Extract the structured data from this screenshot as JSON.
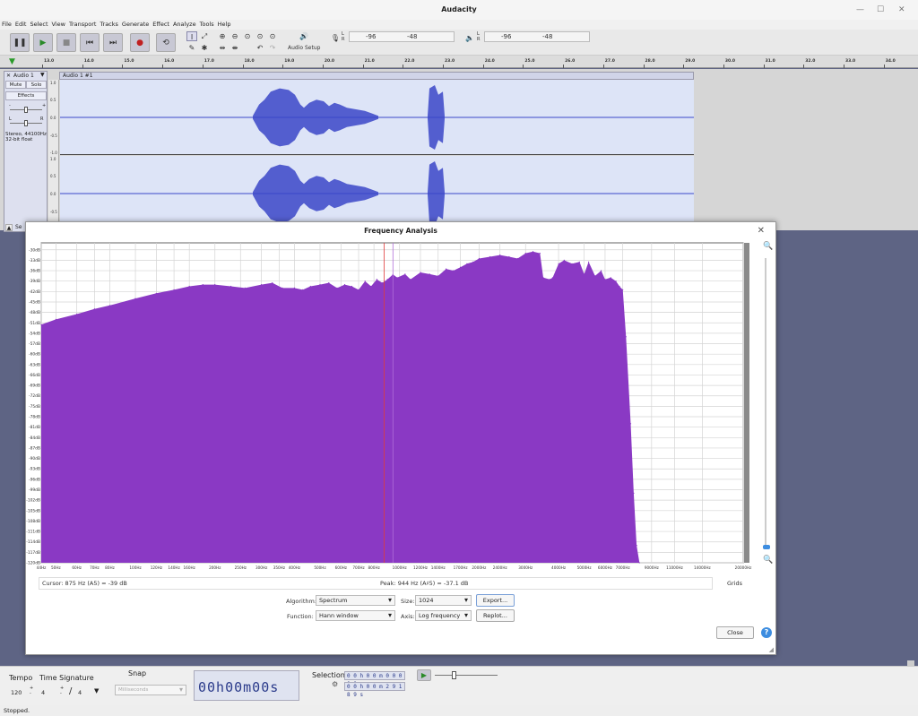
{
  "window": {
    "title": "Audacity"
  },
  "menu": [
    "File",
    "Edit",
    "Select",
    "View",
    "Transport",
    "Tracks",
    "Generate",
    "Effect",
    "Analyze",
    "Tools",
    "Help"
  ],
  "toolbar": {
    "audio_setup_label": "Audio Setup",
    "rec_meter": {
      "ticks": [
        "-96",
        "-48"
      ],
      "lr": "L R"
    },
    "play_meter": {
      "ticks": [
        "-96",
        "-48"
      ],
      "lr": "L R"
    }
  },
  "ruler": {
    "ticks": [
      "13.0",
      "14.0",
      "15.0",
      "16.0",
      "17.0",
      "18.0",
      "19.0",
      "20.0",
      "21.0",
      "22.0",
      "23.0",
      "24.0",
      "25.0",
      "26.0",
      "27.0",
      "28.0",
      "29.0",
      "30.0",
      "31.0",
      "32.0",
      "33.0",
      "34.0"
    ]
  },
  "track": {
    "name": "Audio 1",
    "clip_name": "Audio 1 #1",
    "mute": "Mute",
    "solo": "Solo",
    "effects": "Effects",
    "gain_minus": "-",
    "gain_plus": "+",
    "pan_left": "L",
    "pan_right": "R",
    "info": "Stereo, 44100Hz\n32-bit float",
    "scale": [
      "1.0",
      "0.5",
      "0.0",
      "-0.5",
      "-1.0",
      "1.0",
      "0.5",
      "0.0",
      "-0.5"
    ],
    "select_label": "Se"
  },
  "dialog": {
    "title": "Frequency Analysis",
    "cursor": "Cursor: 875 Hz (A5) = -39 dB",
    "peak": "Peak: 944 Hz (A♯5) = -37.1 dB",
    "grids_label": "Grids",
    "algorithm_label": "Algorithm:",
    "algorithm_value": "Spectrum",
    "size_label": "Size:",
    "size_value": "1024",
    "function_label": "Function:",
    "function_value": "Hann window",
    "axis_label": "Axis:",
    "axis_value": "Log frequency",
    "export_label": "Export...",
    "replot_label": "Replot...",
    "close_label": "Close",
    "help_label": "?"
  },
  "bottom": {
    "tempo_label": "Tempo",
    "tempo_value": "120",
    "time_sig_label": "Time Signature",
    "time_sig_num": "4",
    "time_sig_den": "4",
    "snap_label": "Snap",
    "snap_value": "Milliseconds",
    "time_display": "00h00m00s",
    "selection_label": "Selection",
    "sel_start": "0 0 h 0 0 m 0 0 0 0 0 s",
    "sel_end": "0 0 h 0 0 m 2 9 1 8 9 s"
  },
  "status": "Stopped.",
  "colors": {
    "spectrum_fill": "#8a39c4",
    "waveform": "#3b47c8",
    "cursor_line": "#e03b3b"
  },
  "chart_data": {
    "type": "area",
    "title": "",
    "xlabel": "",
    "ylabel": "",
    "x_scale": "log",
    "y_ticks": [
      "-30dB",
      "-33dB",
      "-36dB",
      "-39dB",
      "-42dB",
      "-45dB",
      "-48dB",
      "-51dB",
      "-54dB",
      "-57dB",
      "-60dB",
      "-63dB",
      "-66dB",
      "-69dB",
      "-72dB",
      "-75dB",
      "-78dB",
      "-81dB",
      "-84dB",
      "-87dB",
      "-90dB",
      "-93dB",
      "-96dB",
      "-99dB",
      "-102dB",
      "-105dB",
      "-108dB",
      "-111dB",
      "-114dB",
      "-117dB",
      "-120dB"
    ],
    "x_ticks": [
      "44Hz",
      "50Hz",
      "60Hz",
      "70Hz",
      "80Hz",
      "100Hz",
      "120Hz",
      "140Hz",
      "160Hz",
      "200Hz",
      "250Hz",
      "300Hz",
      "350Hz",
      "400Hz",
      "500Hz",
      "600Hz",
      "700Hz",
      "800Hz",
      "1000Hz",
      "1200Hz",
      "1400Hz",
      "1700Hz",
      "2000Hz",
      "2400Hz",
      "3000Hz",
      "4000Hz",
      "5000Hz",
      "6000Hz",
      "7000Hz",
      "9000Hz",
      "11000Hz",
      "14000Hz",
      "20000Hz"
    ],
    "xlim": [
      44,
      20000
    ],
    "ylim": [
      -120,
      -28
    ],
    "grid": true,
    "cursor_hz": 875,
    "peak_hz": 944,
    "x": [
      44,
      50,
      60,
      70,
      80,
      100,
      120,
      140,
      160,
      180,
      200,
      230,
      260,
      300,
      330,
      360,
      400,
      430,
      460,
      500,
      540,
      580,
      620,
      660,
      700,
      740,
      780,
      820,
      860,
      900,
      944,
      980,
      1050,
      1100,
      1200,
      1300,
      1400,
      1500,
      1600,
      1700,
      1800,
      1900,
      2000,
      2200,
      2400,
      2600,
      2800,
      3000,
      3200,
      3400,
      3500,
      3700,
      3800,
      4000,
      4200,
      4500,
      4800,
      5000,
      5200,
      5500,
      5800,
      6000,
      6300,
      6600,
      6800,
      7000,
      7200,
      7500,
      7700,
      7900,
      8100
    ],
    "values": [
      -51.5,
      -50.0,
      -48.5,
      -47.0,
      -46.0,
      -44.0,
      -42.5,
      -41.5,
      -40.5,
      -40.0,
      -40.0,
      -40.5,
      -41.0,
      -40.0,
      -39.5,
      -41.0,
      -41.0,
      -41.5,
      -40.5,
      -40.0,
      -39.5,
      -41.0,
      -40.0,
      -40.5,
      -41.5,
      -39.0,
      -40.5,
      -38.5,
      -39.5,
      -38.5,
      -37.1,
      -38.0,
      -37.0,
      -38.5,
      -36.5,
      -37.0,
      -37.5,
      -35.5,
      -36.0,
      -35.0,
      -34.0,
      -33.5,
      -32.5,
      -32.0,
      -31.5,
      -32.0,
      -32.5,
      -31.0,
      -30.5,
      -31.0,
      -38.0,
      -38.5,
      -38.0,
      -34.0,
      -33.0,
      -34.0,
      -33.5,
      -37.0,
      -33.5,
      -37.5,
      -36.0,
      -38.5,
      -38.0,
      -39.0,
      -40.5,
      -41.5,
      -55.0,
      -80.0,
      -100.0,
      -115.0,
      -120.0
    ]
  }
}
